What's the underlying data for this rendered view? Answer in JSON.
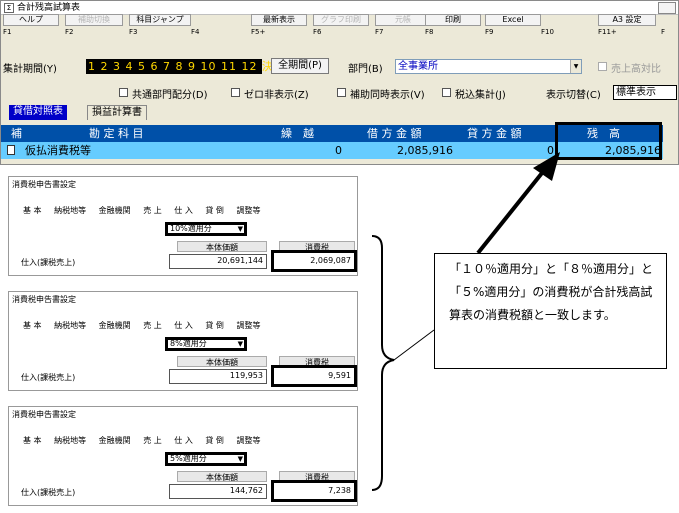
{
  "window": {
    "title": "合計残高試算表",
    "function_keys": [
      {
        "label": "ヘルプ",
        "key": "F1",
        "disabled": false
      },
      {
        "label": "補助切換",
        "key": "F2",
        "disabled": true
      },
      {
        "label": "科目ジャンプ",
        "key": "F3",
        "disabled": false
      },
      {
        "label": "",
        "key": "F4",
        "disabled": false
      },
      {
        "label": "最新表示",
        "key": "F5+",
        "disabled": false
      },
      {
        "label": "グラフ印刷",
        "key": "F6",
        "disabled": true
      },
      {
        "label": "元帳",
        "key": "F7",
        "disabled": true
      },
      {
        "label": "印刷",
        "key": "F8",
        "disabled": false
      },
      {
        "label": "Excel",
        "key": "F9",
        "disabled": false
      },
      {
        "label": "",
        "key": "F10",
        "disabled": false
      },
      {
        "label": "A3 設定",
        "key": "F11+",
        "disabled": false
      },
      {
        "label": "",
        "key": "F",
        "disabled": false
      }
    ],
    "period_label": "集計期間(Y)",
    "period_value": "1 2 3 4 5 6 7 8 9 10 11 12 決",
    "all_period_button": "全期間(P)",
    "dept_label": "部門(B)",
    "dept_value": "全事業所",
    "sales_label": "売上高対比",
    "options": [
      "共通部門配分(D)",
      "ゼロ非表示(Z)",
      "補助同時表示(V)",
      "税込集計(J)"
    ],
    "display_switch_label": "表示切替(C)",
    "display_switch_value": "標準表示",
    "tabs": [
      "貸借対照表",
      "損益計算書"
    ],
    "grid_headers": {
      "aux": "補",
      "account": "勘 定 科 目",
      "carry": "繰　越",
      "debit": "借 方 金 額",
      "credit": "貸 方 金 額",
      "balance": "残　高"
    },
    "grid_row": {
      "account": "仮払消費税等",
      "carry": "0",
      "debit": "2,085,916",
      "credit": "0",
      "balance": "2,085,916"
    }
  },
  "panels": [
    {
      "title": "消費税申告書設定",
      "tabs": [
        "基 本",
        "納税地等",
        "金融機関",
        "売 上",
        "仕 入",
        "貸 倒",
        "調整等"
      ],
      "select_value": "10%適用分",
      "col_base": "本体価額",
      "col_tax": "消費税",
      "row_label": "仕入(課税売上)",
      "base_value": "20,691,144",
      "tax_value": "2,069,087"
    },
    {
      "title": "消費税申告書設定",
      "tabs": [
        "基 本",
        "納税地等",
        "金融機関",
        "売 上",
        "仕 入",
        "貸 倒",
        "調整等"
      ],
      "select_value": "8%適用分",
      "col_base": "本体価額",
      "col_tax": "消費税",
      "row_label": "仕入(課税売上)",
      "base_value": "119,953",
      "tax_value": "9,591"
    },
    {
      "title": "消費税申告書設定",
      "tabs": [
        "基 本",
        "納税地等",
        "金融機関",
        "売 上",
        "仕 入",
        "貸 倒",
        "調整等"
      ],
      "select_value": "5%適用分",
      "col_base": "本体価額",
      "col_tax": "消費税",
      "row_label": "仕入(課税売上)",
      "base_value": "144,762",
      "tax_value": "7,238"
    }
  ],
  "callout": {
    "text": "「１０％適用分」と「８％適用分」と「５%適用分」の消費税が合計残高試算表の消費税額と一致します。"
  }
}
